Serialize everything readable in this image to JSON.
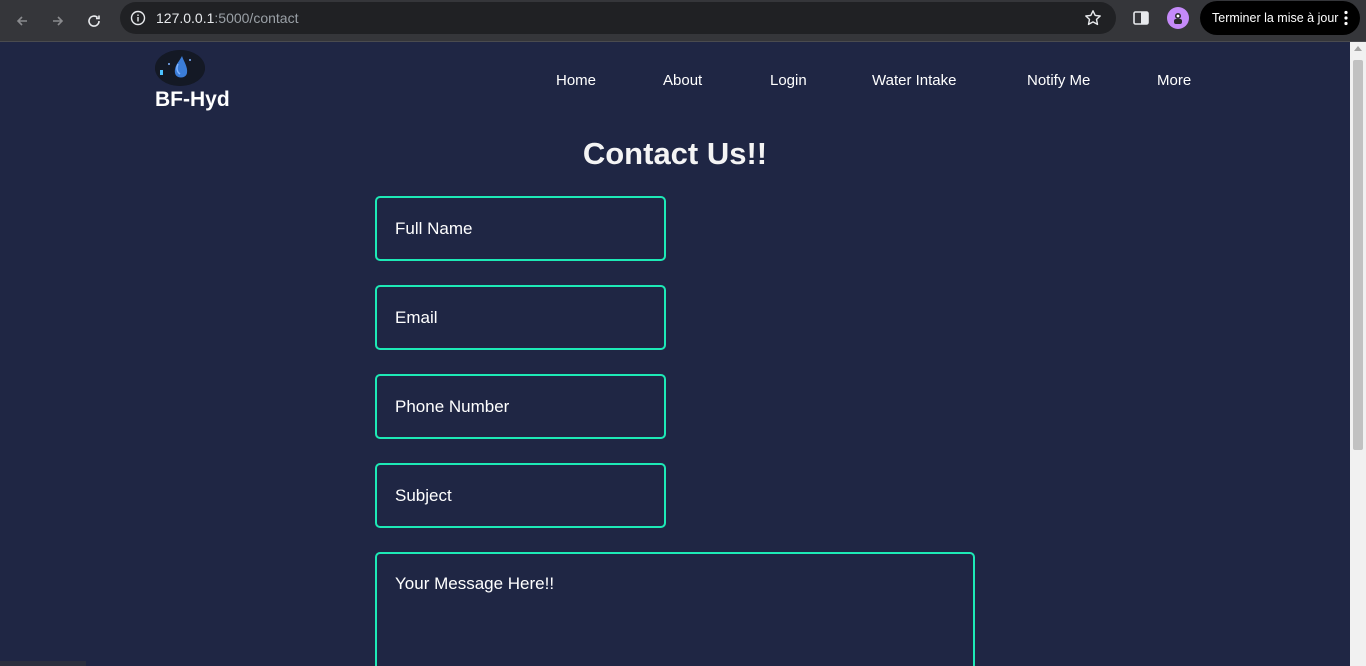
{
  "browser": {
    "url_host": "127.0.0.1",
    "url_path": ":5000/contact",
    "update_button_label": "Terminer la mise à jour"
  },
  "site": {
    "brand": "BF-Hyd",
    "nav": [
      "Home",
      "About",
      "Login",
      "Water Intake",
      "Notify Me",
      "More"
    ]
  },
  "contact": {
    "title": "Contact Us!!",
    "full_name_placeholder": "Full Name",
    "email_placeholder": "Email",
    "phone_placeholder": "Phone Number",
    "subject_placeholder": "Subject",
    "message_placeholder": "Your Message Here!!"
  },
  "colors": {
    "background": "#1f2644",
    "accent": "#1de9b6"
  }
}
